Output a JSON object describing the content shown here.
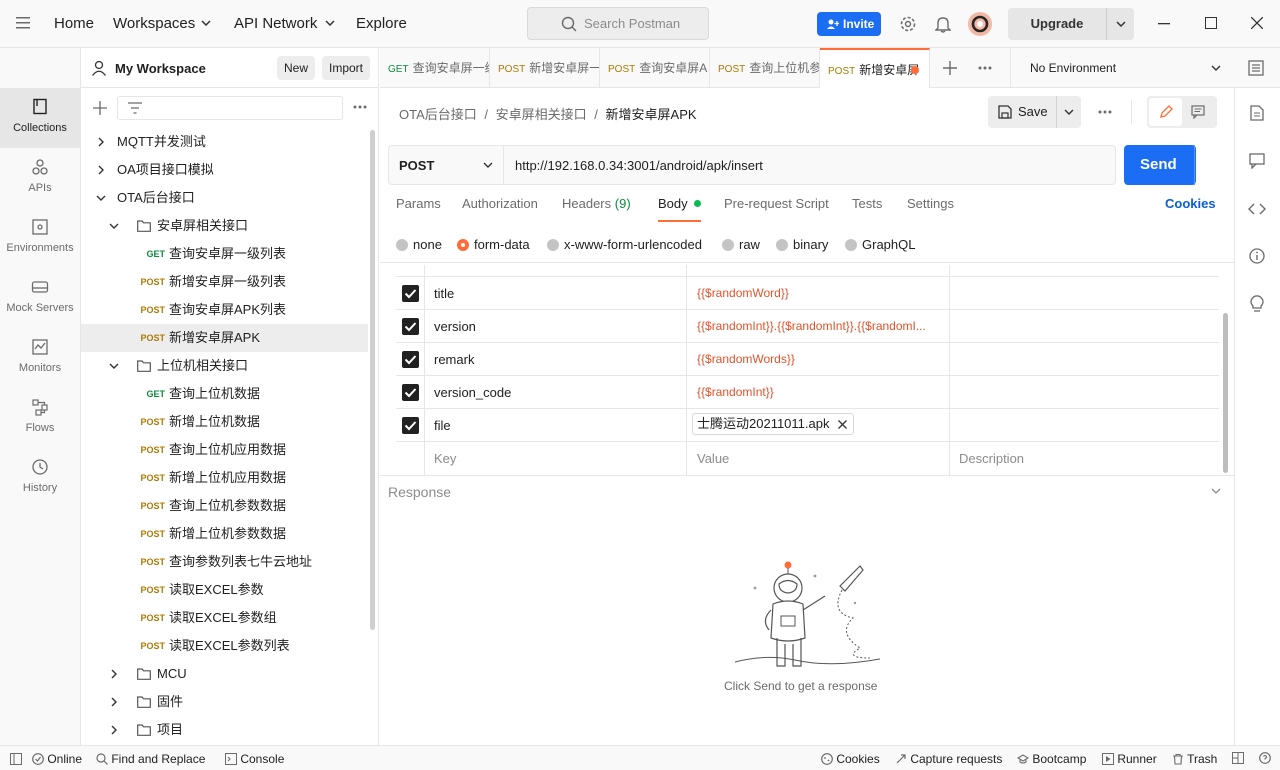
{
  "topbar": {
    "nav": [
      "Home",
      "Workspaces",
      "API Network",
      "Explore"
    ],
    "search_placeholder": "Search Postman",
    "invite_label": "Invite",
    "upgrade_label": "Upgrade"
  },
  "workspace": {
    "name": "My Workspace",
    "new_label": "New",
    "import_label": "Import"
  },
  "rail": [
    {
      "label": "Collections",
      "icon": "collections-icon",
      "active": true
    },
    {
      "label": "APIs",
      "icon": "apis-icon"
    },
    {
      "label": "Environments",
      "icon": "environments-icon"
    },
    {
      "label": "Mock Servers",
      "icon": "mock-servers-icon"
    },
    {
      "label": "Monitors",
      "icon": "monitors-icon"
    },
    {
      "label": "Flows",
      "icon": "flows-icon"
    },
    {
      "label": "History",
      "icon": "history-icon"
    }
  ],
  "tree": [
    {
      "label": "MQTT并发测试",
      "level": 0,
      "kind": "collection",
      "expanded": false
    },
    {
      "label": "OA项目接口模拟",
      "level": 0,
      "kind": "collection",
      "expanded": false
    },
    {
      "label": "OTA后台接口",
      "level": 0,
      "kind": "collection",
      "expanded": true
    },
    {
      "label": "安卓屏相关接口",
      "level": 1,
      "kind": "folder",
      "expanded": true
    },
    {
      "label": "查询安卓屏一级列表",
      "level": 2,
      "kind": "request",
      "method": "GET"
    },
    {
      "label": "新增安卓屏一级列表",
      "level": 2,
      "kind": "request",
      "method": "POST"
    },
    {
      "label": "查询安卓屏APK列表",
      "level": 2,
      "kind": "request",
      "method": "POST"
    },
    {
      "label": "新增安卓屏APK",
      "level": 2,
      "kind": "request",
      "method": "POST",
      "selected": true
    },
    {
      "label": "上位机相关接口",
      "level": 1,
      "kind": "folder",
      "expanded": true
    },
    {
      "label": "查询上位机数据",
      "level": 2,
      "kind": "request",
      "method": "GET"
    },
    {
      "label": "新增上位机数据",
      "level": 2,
      "kind": "request",
      "method": "POST"
    },
    {
      "label": "查询上位机应用数据",
      "level": 2,
      "kind": "request",
      "method": "POST"
    },
    {
      "label": "新增上位机应用数据",
      "level": 2,
      "kind": "request",
      "method": "POST"
    },
    {
      "label": "查询上位机参数数据",
      "level": 2,
      "kind": "request",
      "method": "POST"
    },
    {
      "label": "新增上位机参数数据",
      "level": 2,
      "kind": "request",
      "method": "POST"
    },
    {
      "label": "查询参数列表七牛云地址",
      "level": 2,
      "kind": "request",
      "method": "POST"
    },
    {
      "label": "读取EXCEL参数",
      "level": 2,
      "kind": "request",
      "method": "POST"
    },
    {
      "label": "读取EXCEL参数组",
      "level": 2,
      "kind": "request",
      "method": "POST"
    },
    {
      "label": "读取EXCEL参数列表",
      "level": 2,
      "kind": "request",
      "method": "POST"
    },
    {
      "label": "MCU",
      "level": 1,
      "kind": "folder",
      "expanded": false
    },
    {
      "label": "固件",
      "level": 1,
      "kind": "folder",
      "expanded": false
    },
    {
      "label": "项目",
      "level": 1,
      "kind": "folder",
      "expanded": false
    }
  ],
  "tabs": [
    {
      "method": "GET",
      "label": "查询安卓屏一级"
    },
    {
      "method": "POST",
      "label": "新增安卓屏一"
    },
    {
      "method": "POST",
      "label": "查询安卓屏A"
    },
    {
      "method": "POST",
      "label": "查询上位机参"
    },
    {
      "method": "POST",
      "label": "新增安卓屏",
      "active": true,
      "unsaved": true
    }
  ],
  "environment": "No Environment",
  "breadcrumb": {
    "part1": "OTA后台接口",
    "part2": "安卓屏相关接口",
    "current": "新增安卓屏APK"
  },
  "save_label": "Save",
  "request": {
    "method": "POST",
    "url": "http://192.168.0.34:3001/android/apk/insert",
    "send_label": "Send"
  },
  "request_tabs": {
    "params": "Params",
    "authorization": "Authorization",
    "headers": "Headers",
    "headers_count": "(9)",
    "body": "Body",
    "prerequest": "Pre-request Script",
    "tests": "Tests",
    "settings": "Settings",
    "cookies": "Cookies"
  },
  "body_types": [
    "none",
    "form-data",
    "x-www-form-urlencoded",
    "raw",
    "binary",
    "GraphQL"
  ],
  "body_type_selected": "form-data",
  "form_rows": [
    {
      "key": "title",
      "value": "{{$randomWord}}",
      "checked": true
    },
    {
      "key": "version",
      "value": "{{$randomInt}}.{{$randomInt}}.{{$randomI...",
      "checked": true
    },
    {
      "key": "remark",
      "value": "{{$randomWords}}",
      "checked": true
    },
    {
      "key": "version_code",
      "value": "{{$randomInt}}",
      "checked": true
    },
    {
      "key": "file",
      "value": "士腾运动20211011.apk",
      "checked": true,
      "is_file": true
    }
  ],
  "form_placeholders": {
    "key": "Key",
    "value": "Value",
    "description": "Description"
  },
  "response": {
    "title": "Response",
    "empty_text": "Click Send to get a response"
  },
  "statusbar": {
    "online": "Online",
    "find_replace": "Find and Replace",
    "console": "Console",
    "cookies": "Cookies",
    "capture": "Capture requests",
    "bootcamp": "Bootcamp",
    "runner": "Runner",
    "trash": "Trash"
  },
  "colors": {
    "accent": "#ff6c37",
    "primary": "#1b6ef3",
    "get": "#0f8a3f",
    "post": "#ad7a03",
    "variable": "#e0532b"
  }
}
